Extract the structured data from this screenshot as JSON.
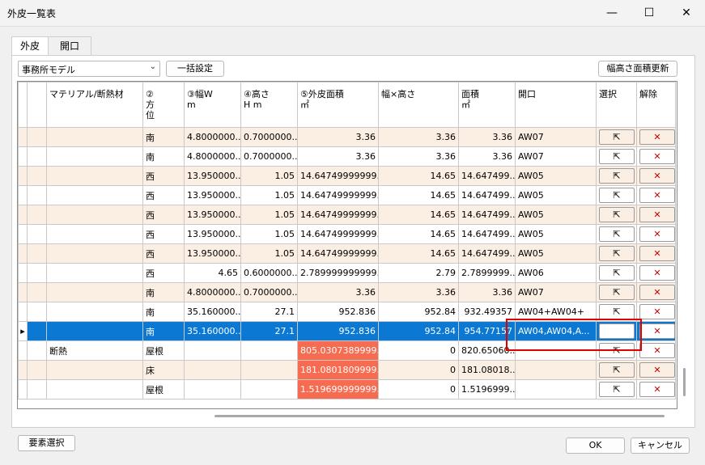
{
  "window": {
    "title": "外皮一覧表",
    "minimize": "—",
    "maximize": "☐",
    "close": "✕"
  },
  "tabs": [
    {
      "label": "外皮"
    },
    {
      "label": "開口"
    }
  ],
  "toolbar": {
    "model_select": "事務所モデル",
    "bulk_button": "一括設定",
    "update_button": "幅高さ面積更新"
  },
  "table": {
    "headers": [
      "マテリアル/断熱材",
      "②\n方\n位",
      "③幅W\nm",
      "④高さ\nH m",
      "⑤外皮面積\n㎡",
      "幅×高さ",
      "面積\n㎡",
      "開口",
      "選択",
      "解除"
    ],
    "rows": [
      {
        "material": "",
        "dir": "南",
        "w": "4.8000000...",
        "h": "0.7000000...",
        "area": "3.36",
        "wh": "3.36",
        "menseki": "3.36",
        "open": "AW07",
        "alt": true
      },
      {
        "material": "",
        "dir": "南",
        "w": "4.8000000...",
        "h": "0.7000000...",
        "area": "3.36",
        "wh": "3.36",
        "menseki": "3.36",
        "open": "AW07",
        "alt": false
      },
      {
        "material": "",
        "dir": "西",
        "w": "13.950000...",
        "h": "1.05",
        "area": "14.64749999999...",
        "wh": "14.65",
        "menseki": "14.647499...",
        "open": "AW05",
        "alt": true
      },
      {
        "material": "",
        "dir": "西",
        "w": "13.950000...",
        "h": "1.05",
        "area": "14.64749999999...",
        "wh": "14.65",
        "menseki": "14.647499...",
        "open": "AW05",
        "alt": false
      },
      {
        "material": "",
        "dir": "西",
        "w": "13.950000...",
        "h": "1.05",
        "area": "14.64749999999...",
        "wh": "14.65",
        "menseki": "14.647499...",
        "open": "AW05",
        "alt": true
      },
      {
        "material": "",
        "dir": "西",
        "w": "13.950000...",
        "h": "1.05",
        "area": "14.64749999999...",
        "wh": "14.65",
        "menseki": "14.647499...",
        "open": "AW05",
        "alt": false
      },
      {
        "material": "",
        "dir": "西",
        "w": "13.950000...",
        "h": "1.05",
        "area": "14.64749999999...",
        "wh": "14.65",
        "menseki": "14.647499...",
        "open": "AW05",
        "alt": true
      },
      {
        "material": "",
        "dir": "西",
        "w": "4.65",
        "h": "0.6000000...",
        "area": "2.789999999999...",
        "wh": "2.79",
        "menseki": "2.7899999...",
        "open": "AW06",
        "alt": false
      },
      {
        "material": "",
        "dir": "南",
        "w": "4.8000000...",
        "h": "0.7000000...",
        "area": "3.36",
        "wh": "3.36",
        "menseki": "3.36",
        "open": "AW07",
        "alt": true
      },
      {
        "material": "",
        "dir": "南",
        "w": "35.160000...",
        "h": "27.1",
        "area": "952.836",
        "wh": "952.84",
        "menseki": "932.49357",
        "open": "AW04+AW04+",
        "alt": false
      },
      {
        "material": "",
        "dir": "南",
        "w": "35.160000...",
        "h": "27.1",
        "area": "952.836",
        "wh": "952.84",
        "menseki": "954.77157",
        "open": "AW04,AW04,A...",
        "alt": false,
        "selected": true
      },
      {
        "material": "断熱",
        "dir": "屋根",
        "w": "",
        "h": "",
        "area": "805.0307389999...",
        "wh": "0",
        "menseki": "820.65060...",
        "open": "",
        "alt": false,
        "red": true
      },
      {
        "material": "",
        "dir": "床",
        "w": "",
        "h": "",
        "area": "181.0801809999...",
        "wh": "0",
        "menseki": "181.08018...",
        "open": "",
        "alt": true,
        "red": true
      },
      {
        "material": "",
        "dir": "屋根",
        "w": "",
        "h": "",
        "area": "1.519699999999...",
        "wh": "0",
        "menseki": "1.5196999...",
        "open": "",
        "alt": false,
        "red": true
      }
    ],
    "select_icon": "⇱",
    "clear_icon": "✕",
    "row_marker": "▸"
  },
  "footer": {
    "element_select": "要素選択",
    "ok": "OK",
    "cancel": "キャンセル"
  },
  "colors": {
    "alt_row": "#fbeee2",
    "selected_row": "#0b78d4",
    "red_cell": "#f76b50",
    "highlight_box": "#e00000"
  }
}
